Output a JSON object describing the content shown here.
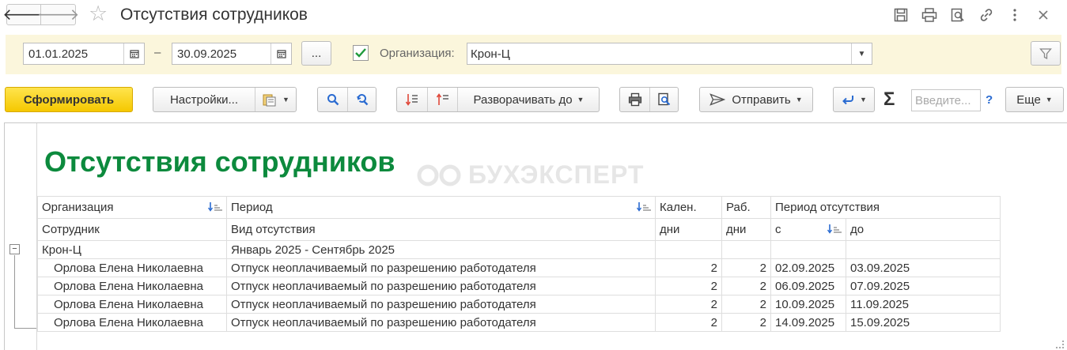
{
  "window": {
    "title": "Отсутствия сотрудников",
    "icons": [
      "save-icon",
      "print-icon",
      "preview-icon",
      "link-icon",
      "more-vertical-icon",
      "close-icon"
    ]
  },
  "filters": {
    "date_from": "01.01.2025",
    "date_to": "30.09.2025",
    "dash": "–",
    "period_button": "...",
    "org_checked": true,
    "org_label": "Организация:",
    "org_value": "Крон-Ц"
  },
  "toolbar": {
    "generate": "Сформировать",
    "settings": "Настройки...",
    "expand_to": "Разворачивать до",
    "send": "Отправить",
    "search_placeholder": "Введите...",
    "help": "?",
    "more": "Еще"
  },
  "report": {
    "title": "Отсутствия сотрудников",
    "watermark": "БУХЭКСПЕРТ",
    "headers_row1": [
      "Организация",
      "Период",
      "Кален.",
      "Раб.",
      "Период отсутствия"
    ],
    "headers_row2": [
      "Сотрудник",
      "Вид отсутствия",
      "дни",
      "дни",
      "с",
      "до"
    ],
    "group": {
      "org": "Крон-Ц",
      "period": "Январь 2025 - Сентябрь 2025"
    },
    "rows": [
      {
        "employee": "Орлова Елена Николаевна",
        "type": "Отпуск неоплачиваемый по разрешению работодателя",
        "cal": "2",
        "work": "2",
        "from": "02.09.2025",
        "to": "03.09.2025"
      },
      {
        "employee": "Орлова Елена Николаевна",
        "type": "Отпуск неоплачиваемый по разрешению работодателя",
        "cal": "2",
        "work": "2",
        "from": "06.09.2025",
        "to": "07.09.2025"
      },
      {
        "employee": "Орлова Елена Николаевна",
        "type": "Отпуск неоплачиваемый по разрешению работодателя",
        "cal": "2",
        "work": "2",
        "from": "10.09.2025",
        "to": "11.09.2025"
      },
      {
        "employee": "Орлова Елена Николаевна",
        "type": "Отпуск неоплачиваемый по разрешению работодателя",
        "cal": "2",
        "work": "2",
        "from": "14.09.2025",
        "to": "15.09.2025"
      }
    ]
  },
  "colors": {
    "title_green": "#0c8a3d",
    "filter_bg": "#fbf6dc",
    "primary_button": "#f5c800",
    "checkbox_green": "#1f9a3c",
    "icon_blue": "#2a6bd1"
  }
}
